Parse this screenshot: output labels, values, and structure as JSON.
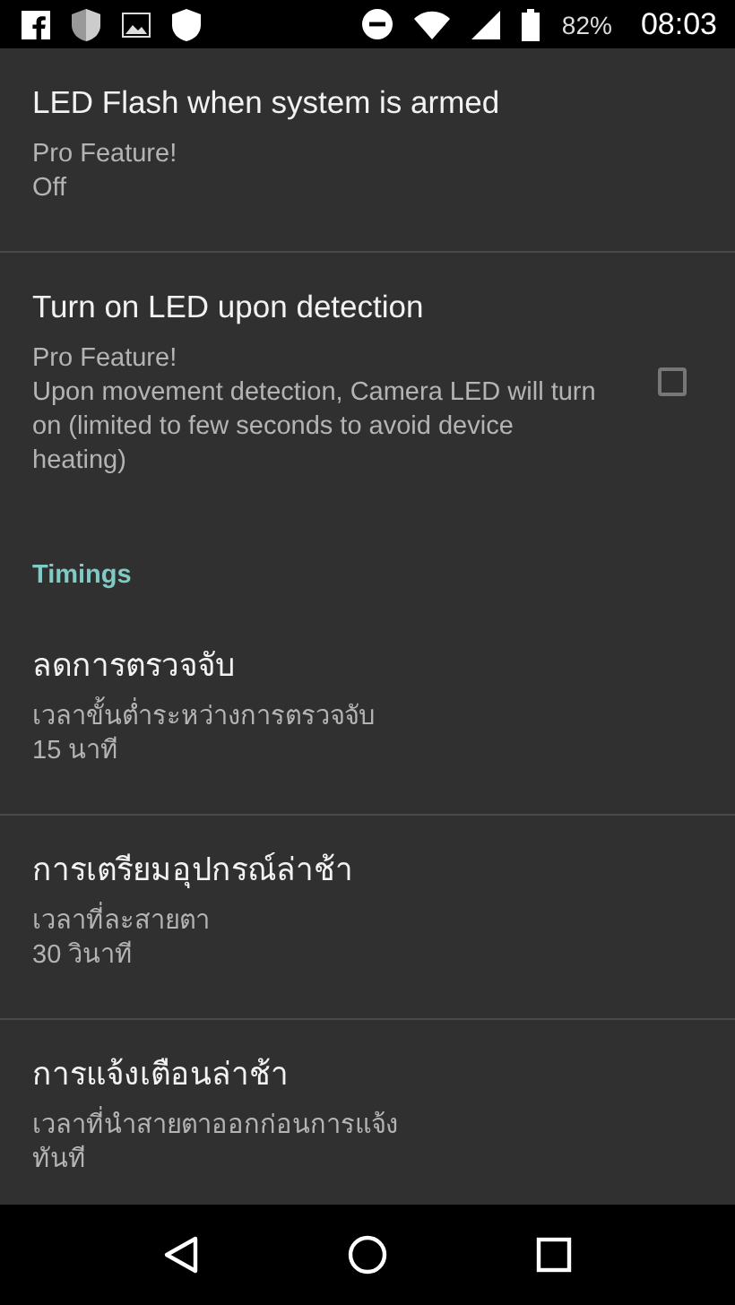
{
  "status_bar": {
    "battery": "82%",
    "time": "08:03"
  },
  "preferences": [
    {
      "kind": "text",
      "title": "LED Flash when system is armed",
      "summary": [
        "Pro Feature!",
        "Off"
      ]
    },
    {
      "kind": "checkbox",
      "title": "Turn on LED upon detection",
      "summary": [
        "Pro Feature!",
        "Upon movement detection, Camera LED will turn on (limited to few seconds to avoid device heating)"
      ],
      "checked": false
    },
    {
      "kind": "category",
      "title": "Timings"
    },
    {
      "kind": "text",
      "title": "ลดการตรวจจับ",
      "summary": [
        "เวลาขั้นต่ำระหว่างการตรวจจับ",
        "15 นาที"
      ]
    },
    {
      "kind": "text",
      "title": "การเตรียมอุปกรณ์ล่าช้า",
      "summary": [
        "เวลาที่ละสายตา",
        "30 วินาที"
      ]
    },
    {
      "kind": "text",
      "title": "การแจ้งเตือนล่าช้า",
      "summary": [
        "เวลาที่นำสายตาออกก่อนการแจ้ง",
        "ทันที"
      ]
    }
  ]
}
